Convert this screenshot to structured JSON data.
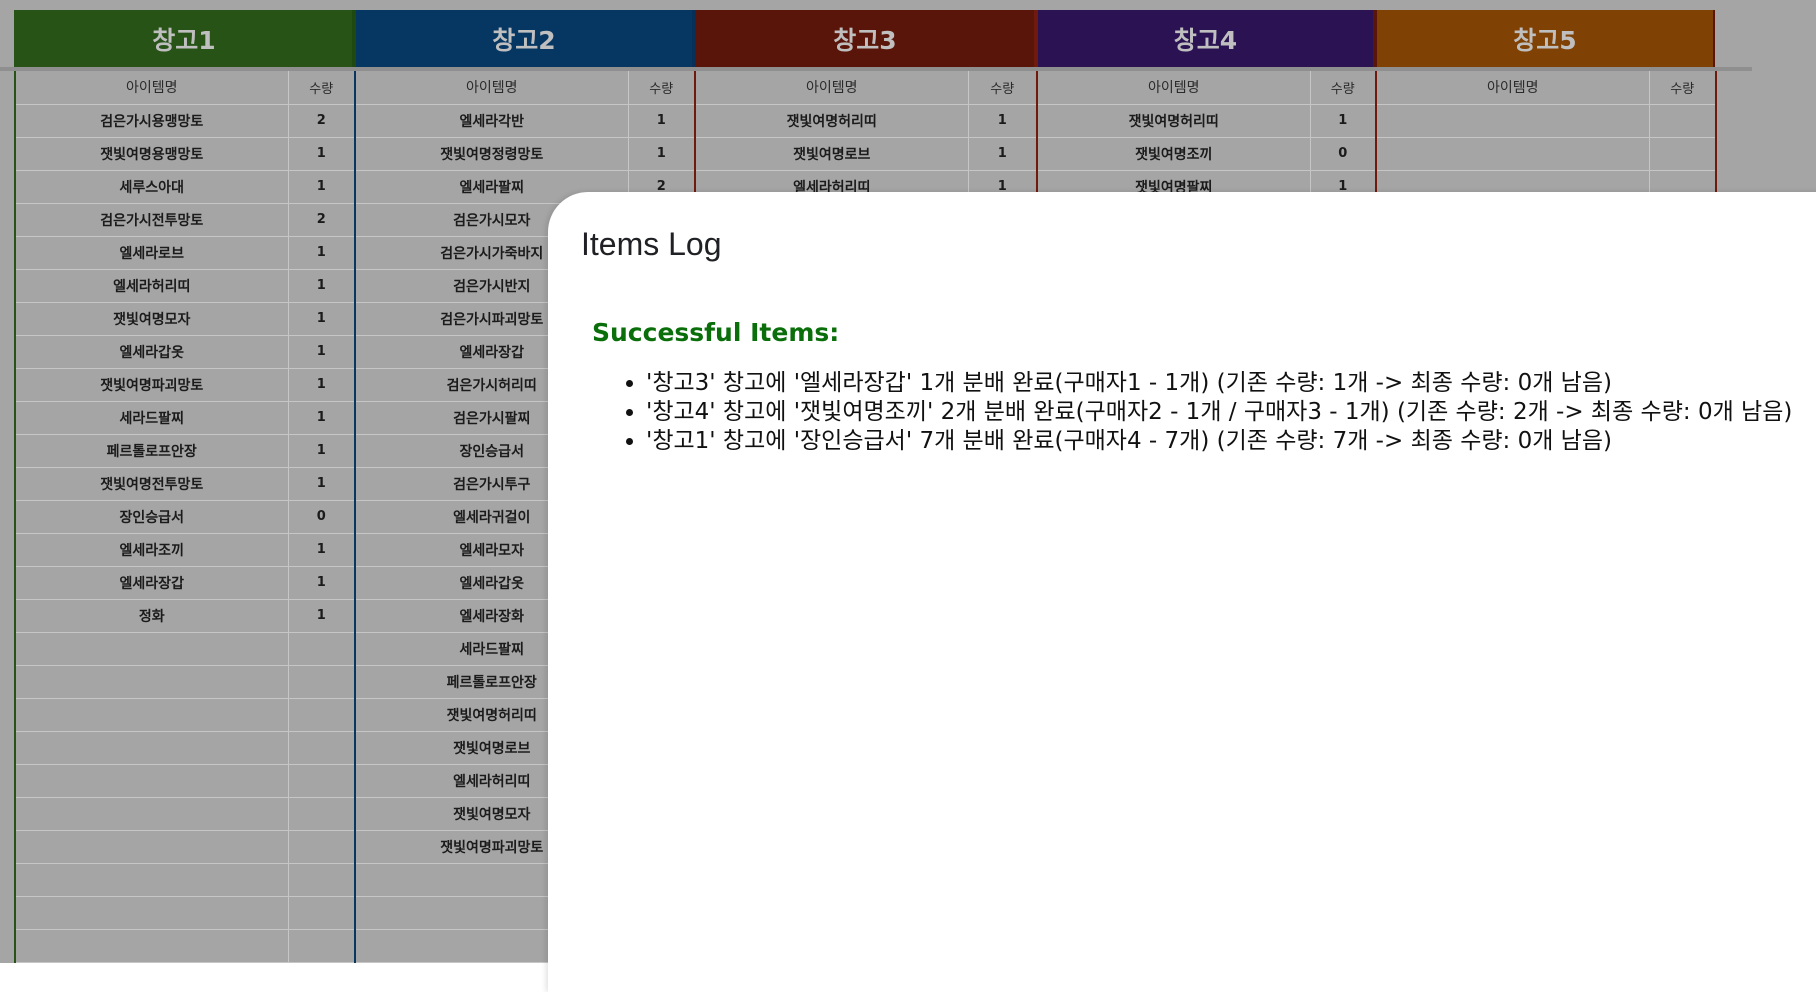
{
  "warehouses": [
    {
      "title": "창고1",
      "color": "#275317",
      "border": "#1e4a12"
    },
    {
      "title": "창고2",
      "color": "#063763",
      "border": "#082f58"
    },
    {
      "title": "창고3",
      "color": "#5a150a",
      "border": "#6f1a0d"
    },
    {
      "title": "창고4",
      "color": "#2b1253",
      "border": "#5a150a"
    },
    {
      "title": "창고5",
      "color": "#7f4104",
      "border": "#5a150a"
    }
  ],
  "columns": {
    "item": "아이템명",
    "qty": "수량"
  },
  "sheet": {
    "w1": [
      [
        "검은가시용맹망토",
        "2"
      ],
      [
        "잿빛여명용맹망토",
        "1"
      ],
      [
        "세루스아대",
        "1"
      ],
      [
        "검은가시전투망토",
        "2"
      ],
      [
        "엘세라로브",
        "1"
      ],
      [
        "엘세라허리띠",
        "1"
      ],
      [
        "잿빛여명모자",
        "1"
      ],
      [
        "엘세라갑옷",
        "1"
      ],
      [
        "잿빛여명파괴망토",
        "1"
      ],
      [
        "세라드팔찌",
        "1"
      ],
      [
        "페르톨로프안장",
        "1"
      ],
      [
        "잿빛여명전투망토",
        "1"
      ],
      [
        "장인승급서",
        "0"
      ],
      [
        "엘세라조끼",
        "1"
      ],
      [
        "엘세라장갑",
        "1"
      ],
      [
        "정화",
        "1"
      ]
    ],
    "w2": [
      [
        "엘세라각반",
        "1"
      ],
      [
        "잿빛여명정령망토",
        "1"
      ],
      [
        "엘세라팔찌",
        "2"
      ],
      [
        "검은가시모자",
        ""
      ],
      [
        "검은가시가죽바지",
        ""
      ],
      [
        "검은가시반지",
        ""
      ],
      [
        "검은가시파괴망토",
        ""
      ],
      [
        "엘세라장갑",
        ""
      ],
      [
        "검은가시허리띠",
        ""
      ],
      [
        "검은가시팔찌",
        ""
      ],
      [
        "장인승급서",
        ""
      ],
      [
        "검은가시투구",
        ""
      ],
      [
        "엘세라귀걸이",
        ""
      ],
      [
        "엘세라모자",
        ""
      ],
      [
        "엘세라갑옷",
        ""
      ],
      [
        "엘세라장화",
        ""
      ],
      [
        "세라드팔찌",
        ""
      ],
      [
        "페르톨로프안장",
        ""
      ],
      [
        "잿빛여명허리띠",
        ""
      ],
      [
        "잿빛여명로브",
        ""
      ],
      [
        "엘세라허리띠",
        ""
      ],
      [
        "잿빛여명모자",
        ""
      ],
      [
        "잿빛여명파괴망토",
        ""
      ]
    ],
    "w3": [
      [
        "잿빛여명허리띠",
        "1"
      ],
      [
        "잿빛여명로브",
        "1"
      ],
      [
        "엘세라허리띠",
        "1"
      ]
    ],
    "w4": [
      [
        "잿빛여명허리띠",
        "1"
      ],
      [
        "잿빛여명조끼",
        "0"
      ],
      [
        "잿빛여명팔찌",
        "1"
      ]
    ],
    "w5": []
  },
  "log": {
    "title": "Items Log",
    "success_label": "Successful Items:",
    "items": [
      "'창고3' 창고에 '엘세라장갑' 1개 분배 완료(구매자1 - 1개) (기존 수량: 1개 -> 최종 수량: 0개 남음)",
      "'창고4' 창고에 '잿빛여명조끼' 2개 분배 완료(구매자2 - 1개 / 구매자3 - 1개) (기존 수량: 2개 -> 최종 수량: 0개 남음)",
      "'창고1' 창고에 '장인승급서' 7개 분배 완료(구매자4 - 7개) (기존 수량: 7개 -> 최종 수량: 0개 남음)"
    ]
  }
}
